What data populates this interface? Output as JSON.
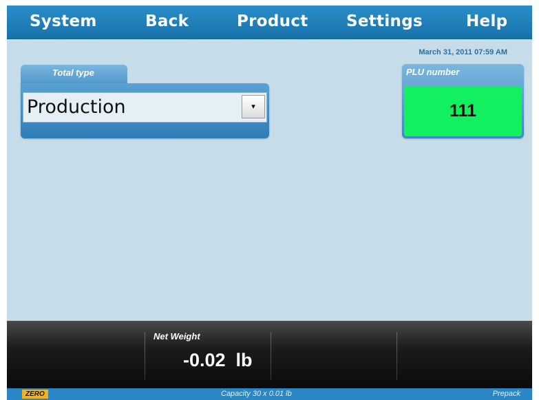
{
  "menu": {
    "system": "System",
    "back": "Back",
    "product": "Product",
    "settings": "Settings",
    "help": "Help"
  },
  "datetime": "March 31, 2011 07:59 AM",
  "total_type": {
    "label": "Total type",
    "selected": "Production"
  },
  "plu": {
    "label": "PLU number",
    "value": "111"
  },
  "weight": {
    "label": "Net Weight",
    "value": "-0.02  lb"
  },
  "status": {
    "zero": "ZERO",
    "capacity": "Capacity 30 x 0.01 lb",
    "mode": "Prepack"
  },
  "colors": {
    "menu_bg": "#1f80bd",
    "plu_bg": "#12f060",
    "zero_bg": "#f2b320"
  }
}
